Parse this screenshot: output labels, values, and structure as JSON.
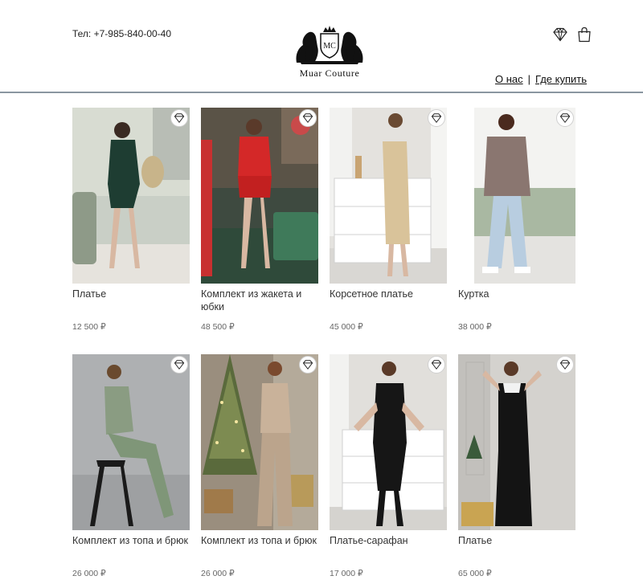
{
  "header": {
    "phone": "Тел: +7-985-840-00-40",
    "brand": "Muar Couture",
    "logo_mark": "MC",
    "icons": [
      "diamond-icon",
      "shopping-bag-icon"
    ],
    "nav": {
      "about": "О нас",
      "separator": "|",
      "where_to_buy": "Где купить"
    }
  },
  "products": [
    {
      "title": "Платье",
      "price": "12 500 ₽"
    },
    {
      "title": "Комплект из жакета и юбки",
      "price": "48 500 ₽"
    },
    {
      "title": "Корсетное платье",
      "price": "45 000 ₽"
    },
    {
      "title": "Куртка",
      "price": "38 000 ₽"
    },
    {
      "title": "Комплект из топа и брюк",
      "price": "26 000 ₽"
    },
    {
      "title": "Комплект из топа и брюк",
      "price": "26 000 ₽"
    },
    {
      "title": "Платье-сарафан",
      "price": "17 000 ₽"
    },
    {
      "title": "Платье",
      "price": "65 000 ₽"
    }
  ],
  "colors": {
    "divider": "#8a96a0",
    "text": "#222222",
    "price": "#666666"
  }
}
